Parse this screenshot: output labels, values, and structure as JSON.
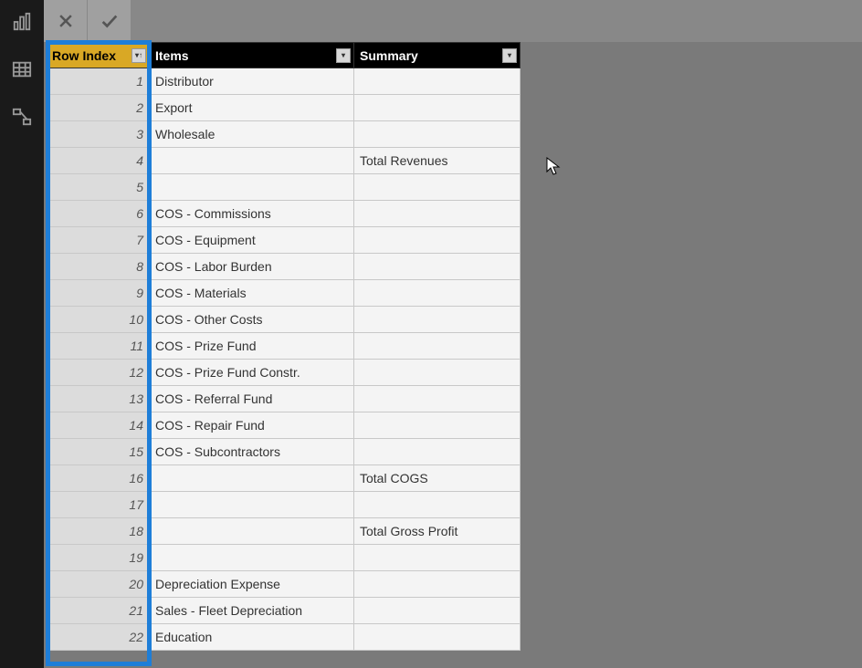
{
  "nav": {
    "report_icon": "report-view-icon",
    "data_icon": "data-view-icon",
    "model_icon": "model-view-icon"
  },
  "formula_bar": {
    "cancel_label": "✕",
    "confirm_label": "✓"
  },
  "table": {
    "columns": {
      "row_index": "Row Index",
      "items": "Items",
      "summary": "Summary"
    },
    "rows": [
      {
        "index": "1",
        "items": "Distributor",
        "summary": ""
      },
      {
        "index": "2",
        "items": "Export",
        "summary": ""
      },
      {
        "index": "3",
        "items": "Wholesale",
        "summary": ""
      },
      {
        "index": "4",
        "items": "",
        "summary": "Total Revenues"
      },
      {
        "index": "5",
        "items": "",
        "summary": ""
      },
      {
        "index": "6",
        "items": "COS - Commissions",
        "summary": ""
      },
      {
        "index": "7",
        "items": "COS - Equipment",
        "summary": ""
      },
      {
        "index": "8",
        "items": "COS - Labor Burden",
        "summary": ""
      },
      {
        "index": "9",
        "items": "COS - Materials",
        "summary": ""
      },
      {
        "index": "10",
        "items": "COS - Other Costs",
        "summary": ""
      },
      {
        "index": "11",
        "items": "COS - Prize Fund",
        "summary": ""
      },
      {
        "index": "12",
        "items": "COS - Prize Fund Constr.",
        "summary": ""
      },
      {
        "index": "13",
        "items": "COS - Referral Fund",
        "summary": ""
      },
      {
        "index": "14",
        "items": "COS - Repair Fund",
        "summary": ""
      },
      {
        "index": "15",
        "items": "COS - Subcontractors",
        "summary": ""
      },
      {
        "index": "16",
        "items": "",
        "summary": "Total COGS"
      },
      {
        "index": "17",
        "items": "",
        "summary": ""
      },
      {
        "index": "18",
        "items": "",
        "summary": "Total Gross Profit"
      },
      {
        "index": "19",
        "items": "",
        "summary": ""
      },
      {
        "index": "20",
        "items": "Depreciation Expense",
        "summary": ""
      },
      {
        "index": "21",
        "items": "Sales - Fleet Depreciation",
        "summary": ""
      },
      {
        "index": "22",
        "items": "Education",
        "summary": ""
      }
    ]
  }
}
